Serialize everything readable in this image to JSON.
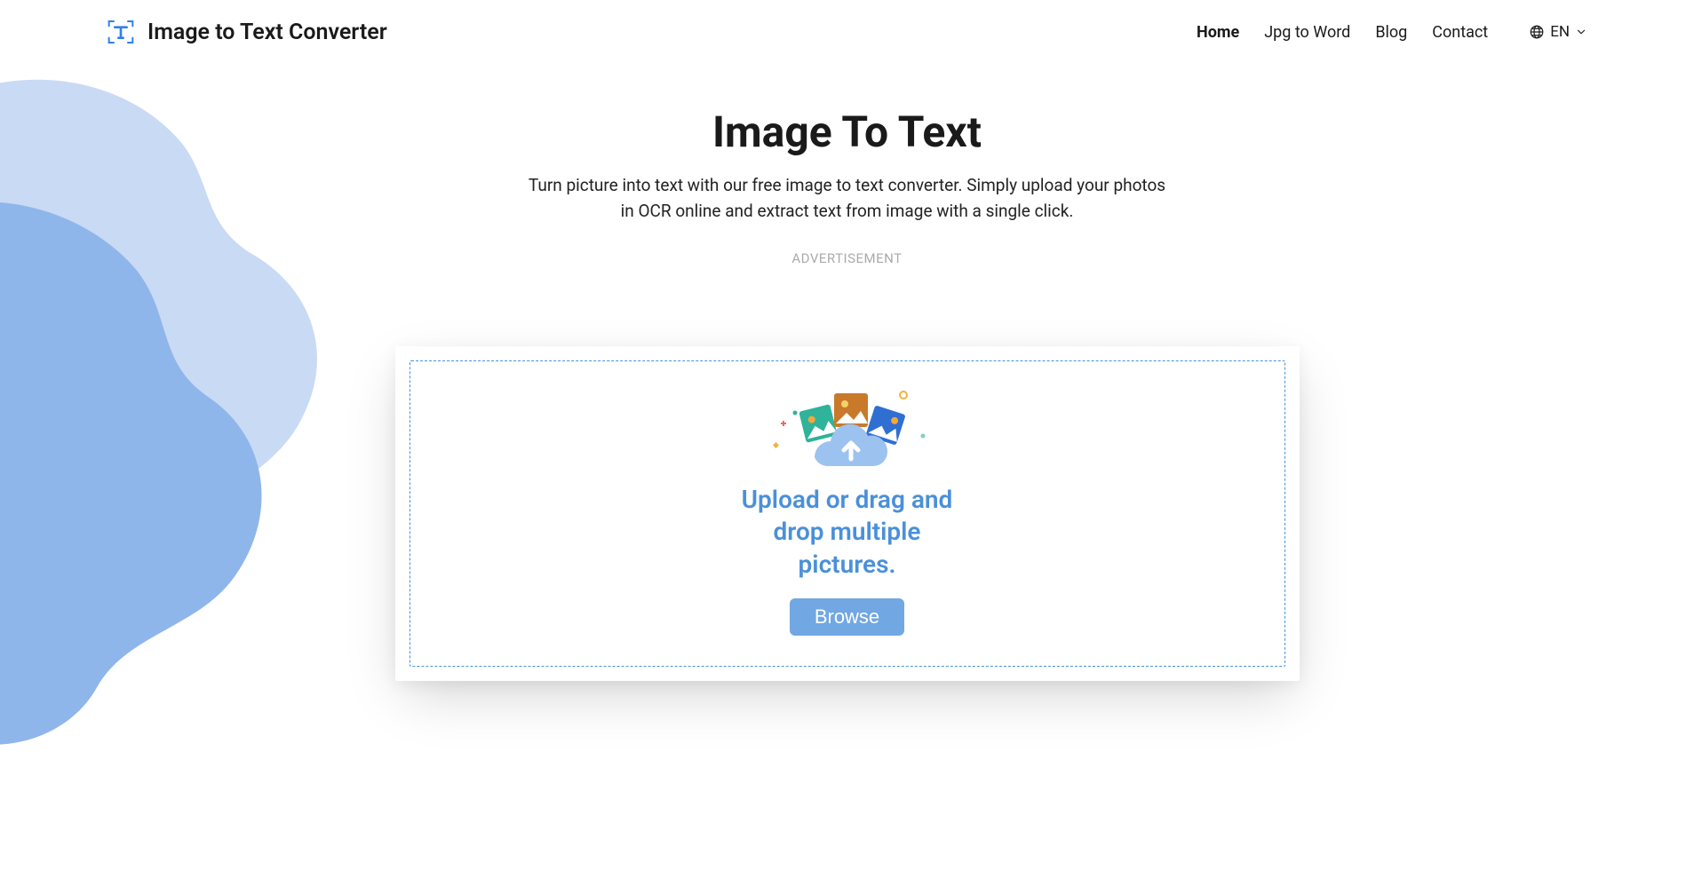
{
  "brand": "Image to Text Converter",
  "nav": {
    "items": [
      {
        "label": "Home",
        "active": true
      },
      {
        "label": "Jpg to Word",
        "active": false
      },
      {
        "label": "Blog",
        "active": false
      },
      {
        "label": "Contact",
        "active": false
      }
    ],
    "lang": "EN"
  },
  "hero": {
    "title": "Image To Text",
    "description": "Turn picture into text with our free image to text converter. Simply upload your photos in OCR online and extract text from image with a single click.",
    "ad_label": "ADVERTISEMENT"
  },
  "upload": {
    "drop_text": "Upload or drag and drop multiple pictures.",
    "browse_label": "Browse"
  },
  "colors": {
    "accent": "#4a90d9",
    "accent_light": "#71a7e3",
    "blob_light": "#c9daf4",
    "blob_dark": "#8fb6ea"
  }
}
